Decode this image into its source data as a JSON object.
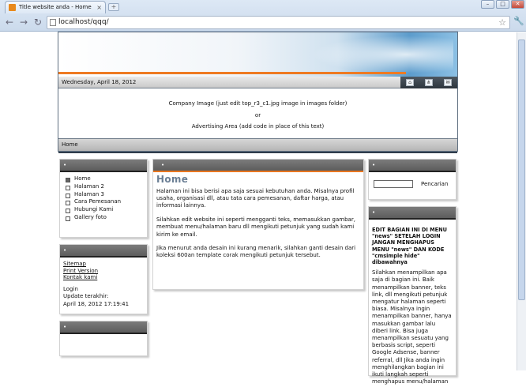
{
  "browser": {
    "tab_title": "Title website anda - Home",
    "tab_close": "×",
    "new_tab": "+",
    "url": "localhost/qqq/",
    "back": "←",
    "forward": "→",
    "reload": "↻",
    "star": "☆",
    "wrench": "🔧",
    "win_min": "–",
    "win_max": "□",
    "win_close": "✕"
  },
  "header": {
    "date": "Wednesday, April 18, 2012",
    "icons": [
      "home-icon",
      "sitemap-icon",
      "mail-icon"
    ],
    "ad_lines": [
      "Company Image (just edit top_r3_c1.jpg image in images folder)",
      "or",
      "Advertising Area (add code in place of this text)"
    ],
    "breadcrumb": "Home",
    "accent": "#ee7a22"
  },
  "left": {
    "menu_head": "•",
    "menu": [
      "Home",
      "Halaman 2",
      "Halaman 3",
      "Cara Pemesanan",
      "Hubungi Kami",
      "Gallery foto"
    ],
    "info_head": "•",
    "links": [
      "Sitemap",
      "Print Version",
      "Kontak kami"
    ],
    "login": "Login",
    "update_label": "Update terakhir:",
    "update_value": "April 18, 2012 17:19:41",
    "extra_head": "•"
  },
  "main": {
    "head": "•",
    "title": "Home",
    "p1": "Halaman ini bisa berisi apa saja sesuai kebutuhan anda. Misalnya profil usaha, organisasi dll, atau tata cara pemesanan, daftar harga, atau informasi lainnya.",
    "p2": "Silahkan edit website ini seperti mengganti teks, memasukkan gambar, membuat menu/halaman baru dll mengikuti petunjuk yang sudah kami kirim ke email.",
    "p3": "Jika menurut anda desain ini kurang menarik, silahkan ganti desain dari koleksi 600an template corak mengikuti petunjuk tersebut."
  },
  "right": {
    "search_head": "•",
    "search_value": "",
    "search_label": "Pencarian",
    "text_head": "•",
    "bold_text": "EDIT BAGIAN INI DI MENU \"news\" SETELAH LOGIN JANGAN MENGHAPUS MENU \"news\" DAN KODE \"cmsimple hide\" dibawahnya",
    "body_text": "Silahkan menampilkan apa saja di bagian ini. Baik menampilkan banner, teks link, dll mengikuti petunjuk mengatur halaman seperti biasa. Misalnya ingin menampilkan banner, hanya masukkan gambar lalu diberi link. Bisa juga menampilkan sesuatu yang berbasis script, seperti Google Adsense, banner referral, dll Jika anda ingin menghilangkan bagian ini ikuti langkah seperti menghapus menu/halaman"
  }
}
